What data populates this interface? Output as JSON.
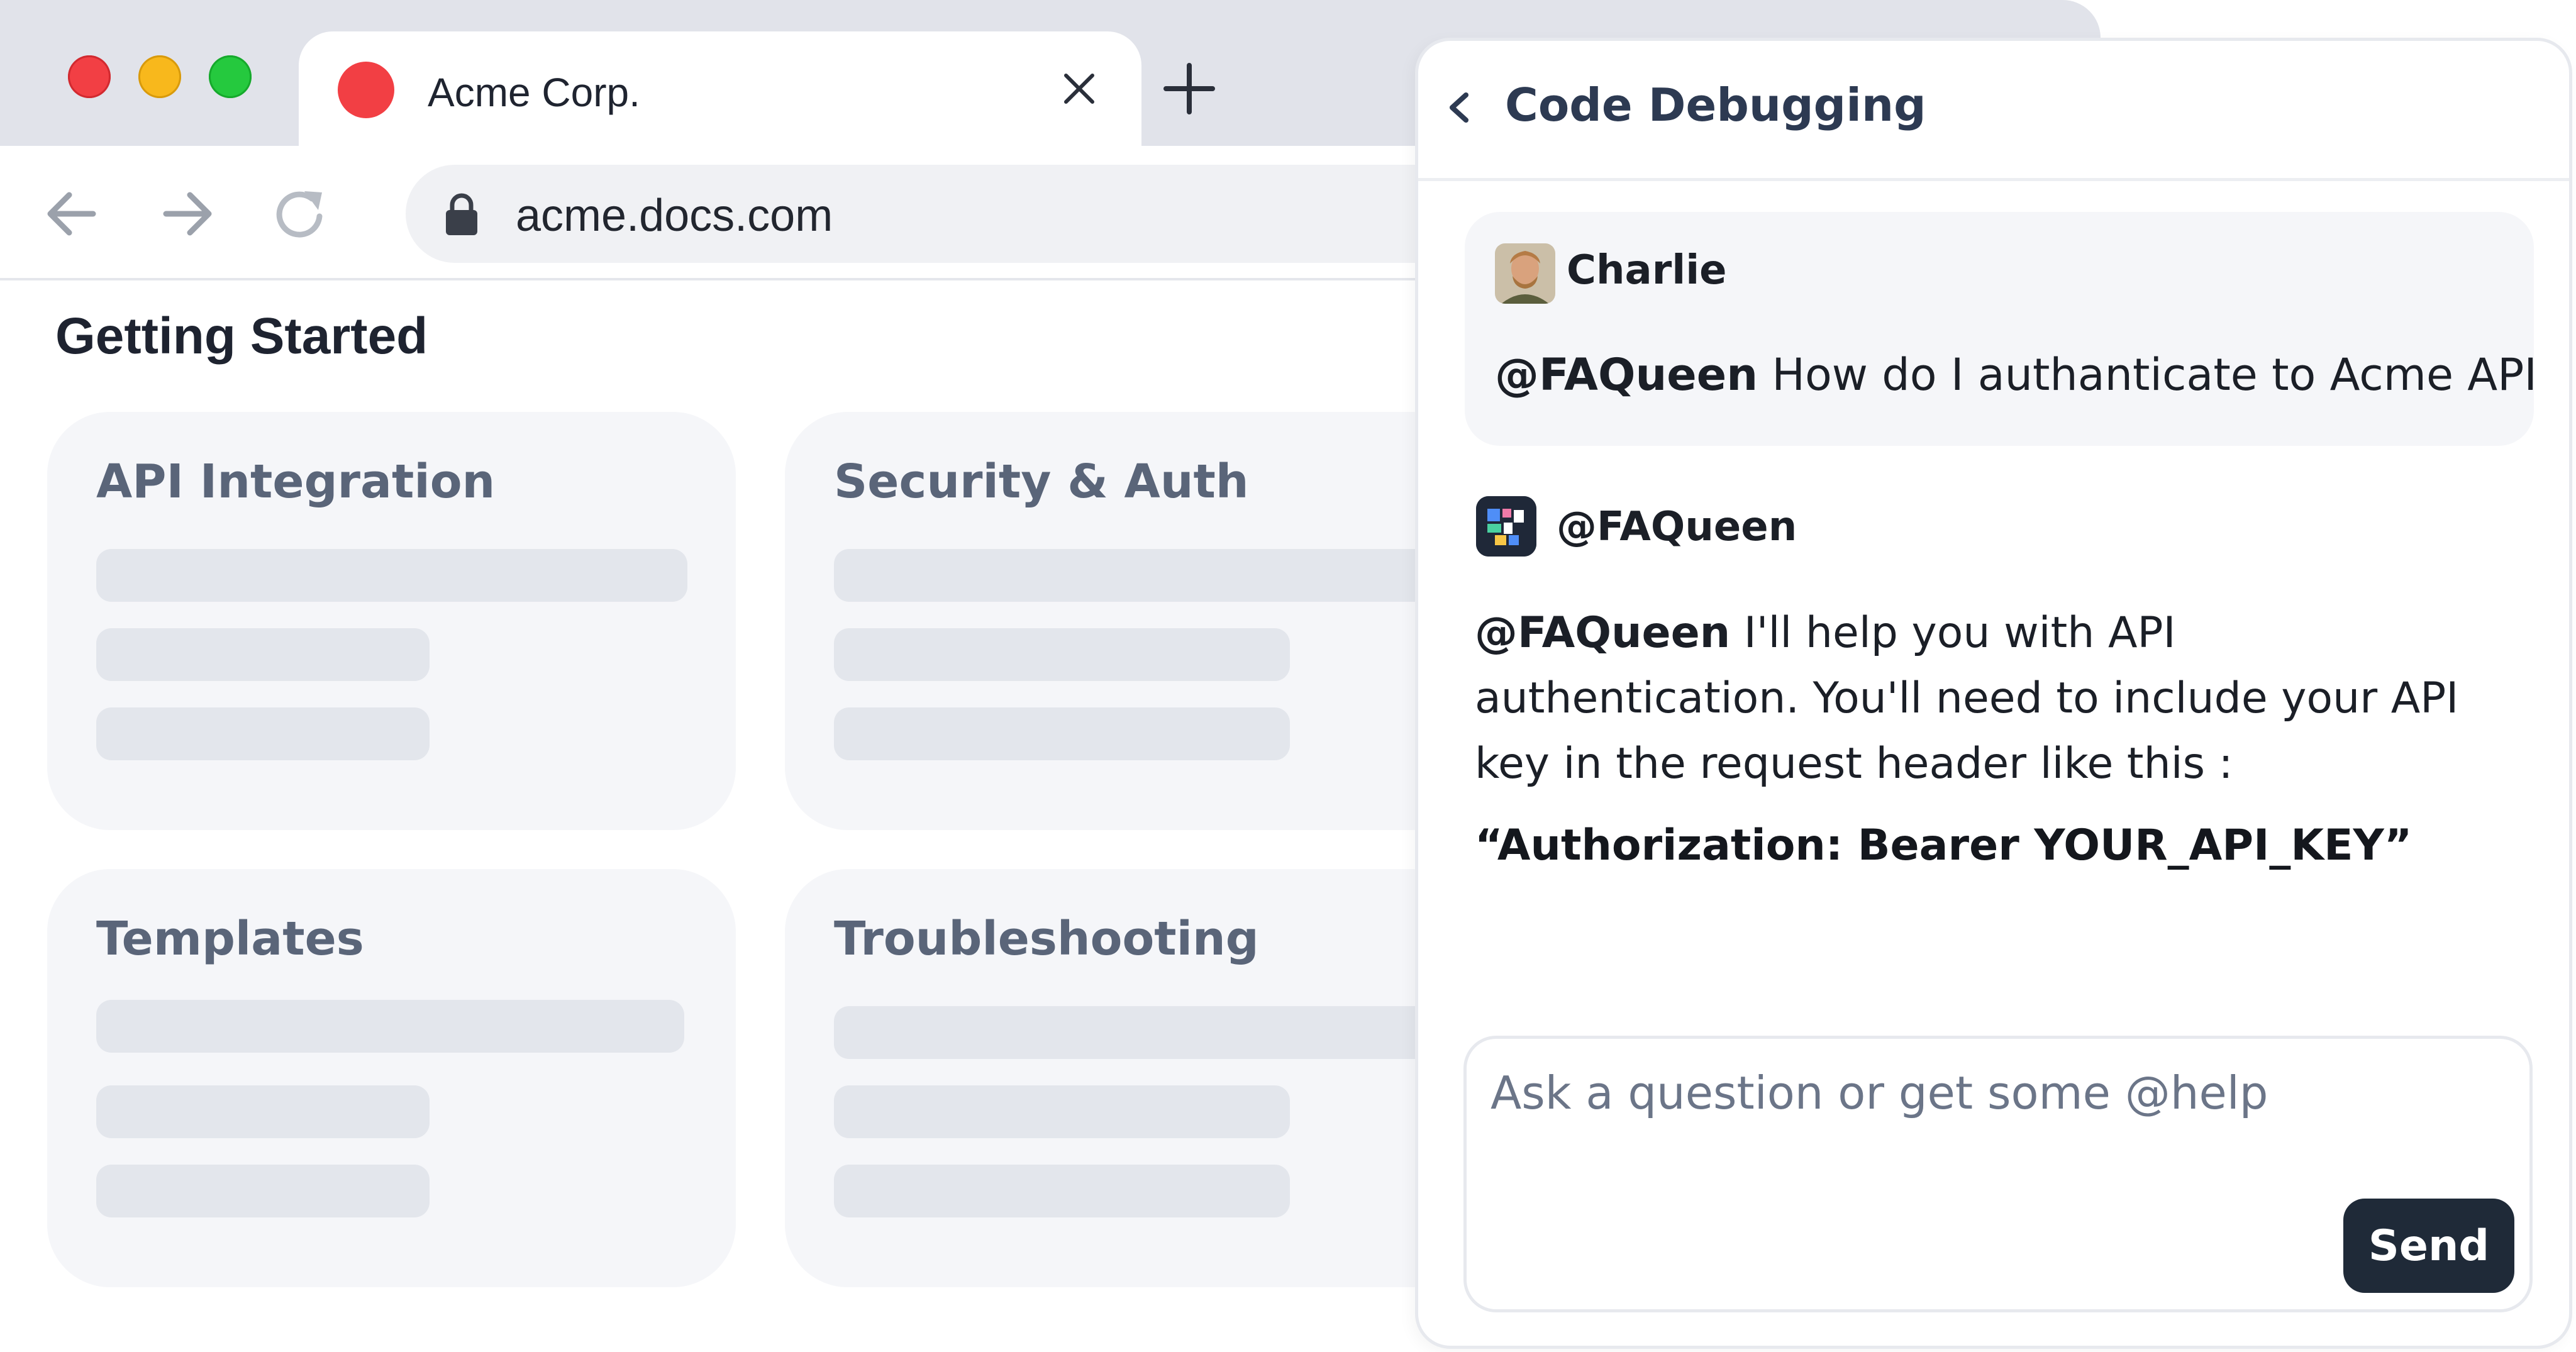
{
  "browser": {
    "traffic_lights": [
      "close",
      "minimize",
      "maximize"
    ],
    "tab": {
      "title": "Acme Corp.",
      "favicon_color": "#f23f44"
    },
    "address_bar": {
      "url": "acme.docs.com"
    }
  },
  "docs": {
    "page_title": "Getting Started",
    "cards": [
      {
        "title": "API Integration"
      },
      {
        "title": "Security & Auth"
      },
      {
        "title": "Templates"
      },
      {
        "title": "Troubleshooting"
      }
    ]
  },
  "chat": {
    "title": "Code Debugging",
    "messages": [
      {
        "author": "Charlie",
        "mention": "@FAQueen",
        "text": " How do I authanticate to Acme API"
      },
      {
        "author": "@FAQueen",
        "mention": "@FAQueen",
        "text": " I'll help you with API authentication. You'll need to include your API key in the request header like this :",
        "code": "“Authorization: Bearer YOUR_API_KEY”"
      }
    ],
    "composer": {
      "placeholder": "Ask a question or get some @help",
      "value": "",
      "send_label": "Send"
    }
  },
  "colors": {
    "accent": "#1f2a38",
    "page_bg": "#ffffff",
    "card_bg": "#f5f6f9"
  }
}
